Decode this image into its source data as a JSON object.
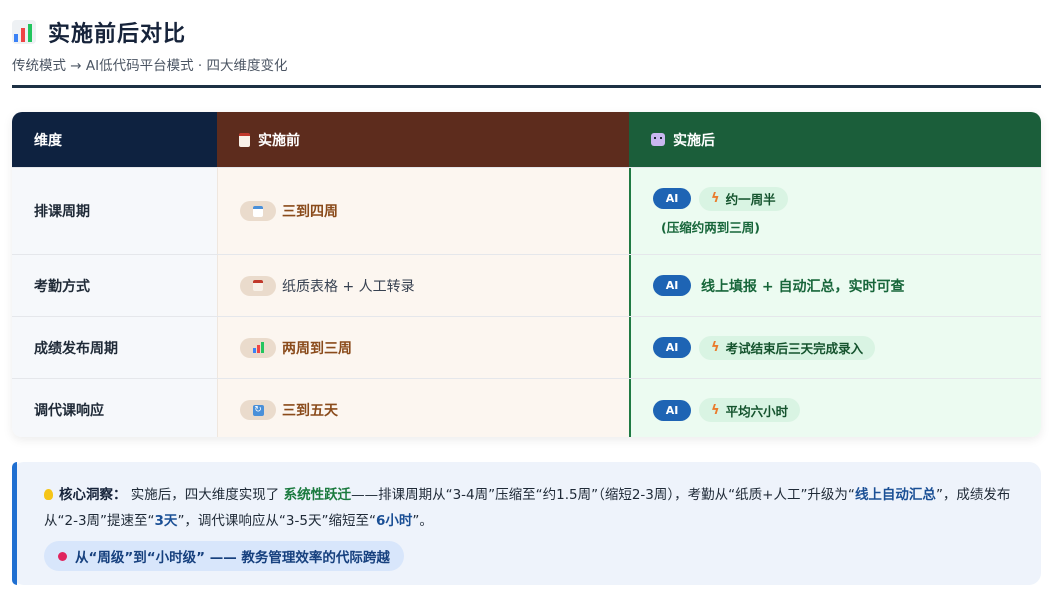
{
  "header": {
    "title": "实施前后对比",
    "subtitle": "传统模式 → AI低代码平台模式 · 四大维度变化",
    "icon": "bar-chart-icon"
  },
  "table": {
    "headers": {
      "dimension": "维度",
      "before": "实施前",
      "after": "实施后"
    },
    "header_icons": {
      "before": "clipboard-icon",
      "after": "robot-icon"
    },
    "ai_label": "AI",
    "rows": [
      {
        "dimension": "排课周期",
        "before_icon": "calendar-icon",
        "before": "三到四周",
        "after": "约一周半",
        "after_note": "(压缩约两到三周)"
      },
      {
        "dimension": "考勤方式",
        "before_icon": "clipboard-icon",
        "before": "纸质表格 + 人工转录",
        "after": "线上填报 + 自动汇总，实时可查"
      },
      {
        "dimension": "成绩发布周期",
        "before_icon": "bar-chart-icon",
        "before": "两周到三周",
        "after": "考试结束后三天完成录入"
      },
      {
        "dimension": "调代课响应",
        "before_icon": "refresh-icon",
        "before": "三到五天",
        "after": "平均六小时"
      }
    ]
  },
  "insight": {
    "icon": "lightbulb-icon",
    "label": "核心洞察：",
    "p1": "实施后，四大维度实现了 ",
    "h1": "系统性跃迁",
    "p2": "——排课周期从“3-4周”压缩至“约1.5周”（缩短2-3周），考勤从“纸质+人工”升级为“",
    "h2": "线上自动汇总",
    "p3": "”，成绩发布从“2-3周”提速至“",
    "h3": "3天",
    "p4": "”，调代课响应从“3-5天”缩短至“",
    "h4": "6小时",
    "p5": "”。",
    "tagline_icon": "pin-icon",
    "tagline": "从“周级”到“小时级” —— 教务管理效率的代际跨越"
  },
  "colors": {
    "header_dimension": "#0e2240",
    "header_before": "#5d2c1d",
    "header_after": "#1b5e3a",
    "ai_badge": "#1e64b4",
    "accent_green": "#17663a"
  }
}
